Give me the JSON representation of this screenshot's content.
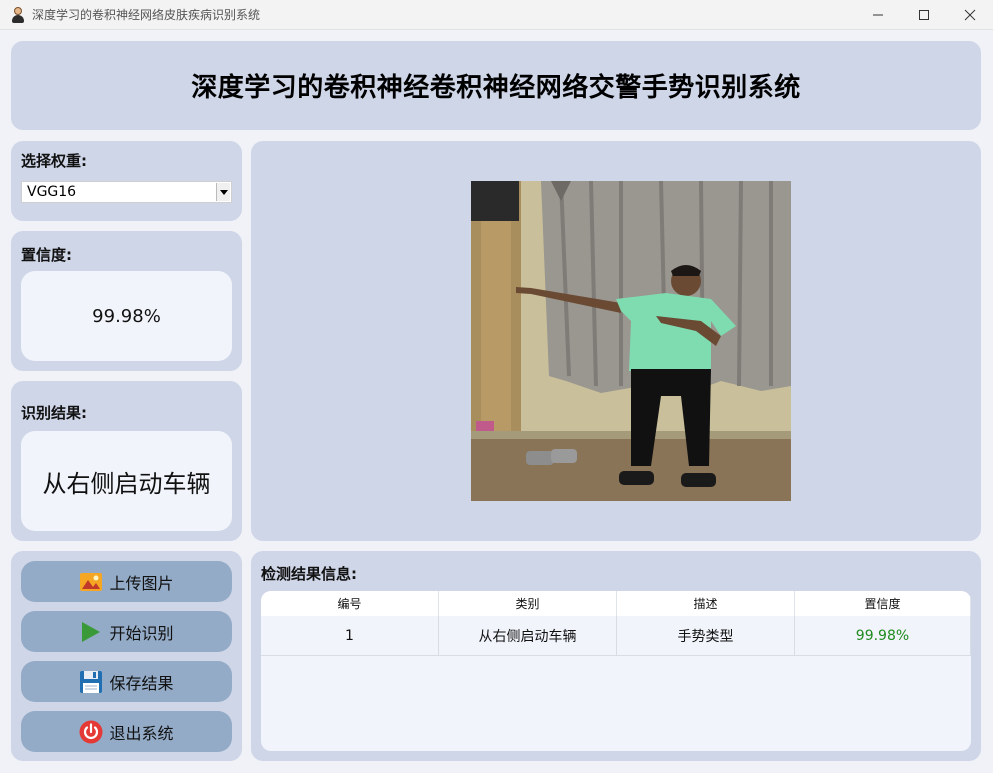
{
  "window": {
    "title": "深度学习的卷积神经网络皮肤疾病识别系统"
  },
  "header": {
    "title": "深度学习的卷积神经卷积神经网络交警手势识别系统"
  },
  "weight": {
    "label": "选择权重:",
    "selected": "VGG16"
  },
  "confidence": {
    "label": "置信度:",
    "value": "99.98%"
  },
  "result": {
    "label": "识别结果:",
    "value": "从右侧启动车辆"
  },
  "buttons": {
    "upload": "上传图片",
    "start": "开始识别",
    "save": "保存结果",
    "exit": "退出系统"
  },
  "table": {
    "title": "检测结果信息:",
    "columns": [
      "编号",
      "类别",
      "描述",
      "置信度"
    ],
    "rows": [
      [
        "1",
        "从右侧启动车辆",
        "手势类型",
        "99.98%"
      ]
    ]
  },
  "colors": {
    "panel": "#cfd6e8",
    "button": "#93abc7",
    "confidence_text": "#1f8a1f"
  }
}
